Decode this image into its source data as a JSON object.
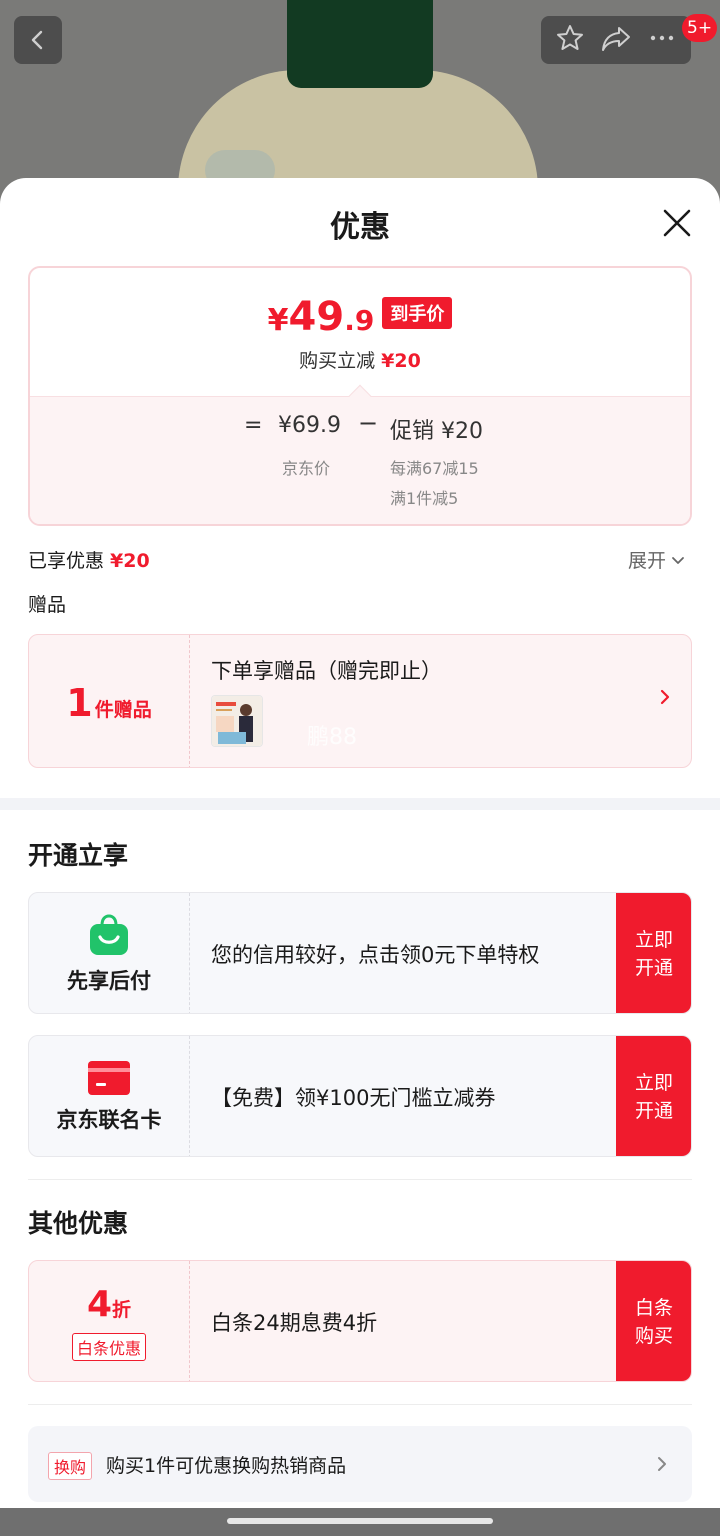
{
  "header": {
    "badge_count": "5+"
  },
  "sheet": {
    "title": "优惠"
  },
  "price": {
    "yen": "¥",
    "int": "49",
    "dec": ".9",
    "tag": "到手价",
    "reduce_label": "购买立减",
    "reduce_value": "¥20",
    "equals": "=",
    "base_price": "¥69.9",
    "minus": "−",
    "promo": "促销 ¥20",
    "base_label": "京东价",
    "promo_line1": "每满67减15",
    "promo_line2": "满1件减5"
  },
  "enjoyed": {
    "label": "已享优惠",
    "value": "¥20",
    "expand_label": "展开"
  },
  "gift": {
    "section_label": "赠品",
    "count": "1",
    "unit": "件赠品",
    "text": "下单享赠品（赠完即止）",
    "watermark": "鹏88"
  },
  "activate": {
    "title": "开通立享",
    "cards": [
      {
        "label": "先享后付",
        "text": "您的信用较好，点击领0元下单特权",
        "button": "立即开通"
      },
      {
        "label": "京东联名卡",
        "text": "【免费】领¥100无门槛立减券",
        "button": "立即开通"
      }
    ]
  },
  "other": {
    "title": "其他优惠",
    "discount_num": "4",
    "discount_unit": "折",
    "discount_tag": "白条优惠",
    "text": "白条24期息费4折",
    "button": "白条购买"
  },
  "exchange": {
    "tag": "换购",
    "text": "购买1件可优惠换购热销商品"
  },
  "colors": {
    "accent": "#f01b2d",
    "pink_bg": "#fdf3f4",
    "green_icon": "#21c36a"
  }
}
